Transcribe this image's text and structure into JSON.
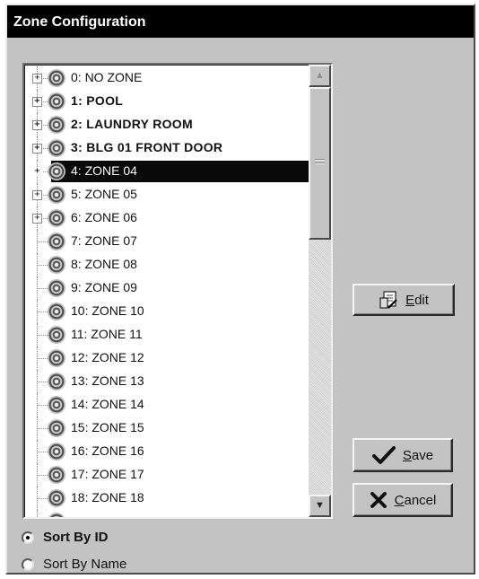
{
  "window": {
    "title": "Zone Configuration"
  },
  "zones": [
    {
      "label": "0: NO ZONE",
      "bold": false,
      "expandable": true,
      "selected": false
    },
    {
      "label": "1: POOL",
      "bold": true,
      "expandable": true,
      "selected": false
    },
    {
      "label": "2: LAUNDRY ROOM",
      "bold": true,
      "expandable": true,
      "selected": false
    },
    {
      "label": "3: BLG 01 FRONT DOOR",
      "bold": true,
      "expandable": true,
      "selected": false
    },
    {
      "label": "4: ZONE 04",
      "bold": false,
      "expandable": true,
      "selected": true
    },
    {
      "label": "5: ZONE 05",
      "bold": false,
      "expandable": true,
      "selected": false
    },
    {
      "label": "6: ZONE 06",
      "bold": false,
      "expandable": true,
      "selected": false
    },
    {
      "label": "7: ZONE 07",
      "bold": false,
      "expandable": false,
      "selected": false
    },
    {
      "label": "8: ZONE 08",
      "bold": false,
      "expandable": false,
      "selected": false
    },
    {
      "label": "9: ZONE 09",
      "bold": false,
      "expandable": false,
      "selected": false
    },
    {
      "label": "10: ZONE 10",
      "bold": false,
      "expandable": false,
      "selected": false
    },
    {
      "label": "11: ZONE 11",
      "bold": false,
      "expandable": false,
      "selected": false
    },
    {
      "label": "12: ZONE 12",
      "bold": false,
      "expandable": false,
      "selected": false
    },
    {
      "label": "13: ZONE 13",
      "bold": false,
      "expandable": false,
      "selected": false
    },
    {
      "label": "14: ZONE 14",
      "bold": false,
      "expandable": false,
      "selected": false
    },
    {
      "label": "15: ZONE 15",
      "bold": false,
      "expandable": false,
      "selected": false
    },
    {
      "label": "16: ZONE 16",
      "bold": false,
      "expandable": false,
      "selected": false
    },
    {
      "label": "17: ZONE 17",
      "bold": false,
      "expandable": false,
      "selected": false
    },
    {
      "label": "18: ZONE 18",
      "bold": false,
      "expandable": false,
      "selected": false
    },
    {
      "label": "",
      "bold": false,
      "expandable": false,
      "selected": false
    }
  ],
  "scrollbar": {
    "up_icon": "scroll-up-arrow-icon",
    "down_icon": "scroll-down-arrow-icon",
    "position": 0.0
  },
  "buttons": {
    "edit": {
      "mnemonic": "E",
      "rest": "dit",
      "icon": "edit-document-icon"
    },
    "save": {
      "mnemonic": "S",
      "rest": "ave",
      "icon": "checkmark-icon"
    },
    "cancel": {
      "mnemonic": "C",
      "rest": "ancel",
      "icon": "x-mark-icon"
    }
  },
  "sort": {
    "by_id": {
      "prefix": "Sort By ",
      "mnemonic": "ID",
      "checked": true
    },
    "by_name": {
      "prefix": "Sort By ",
      "mnemonic": "N",
      "rest": "ame",
      "checked": false
    }
  },
  "colors": {
    "title_bg": "#000000",
    "dialog_bg": "#c3c3c3",
    "selection_bg": "#0a0a0a"
  }
}
